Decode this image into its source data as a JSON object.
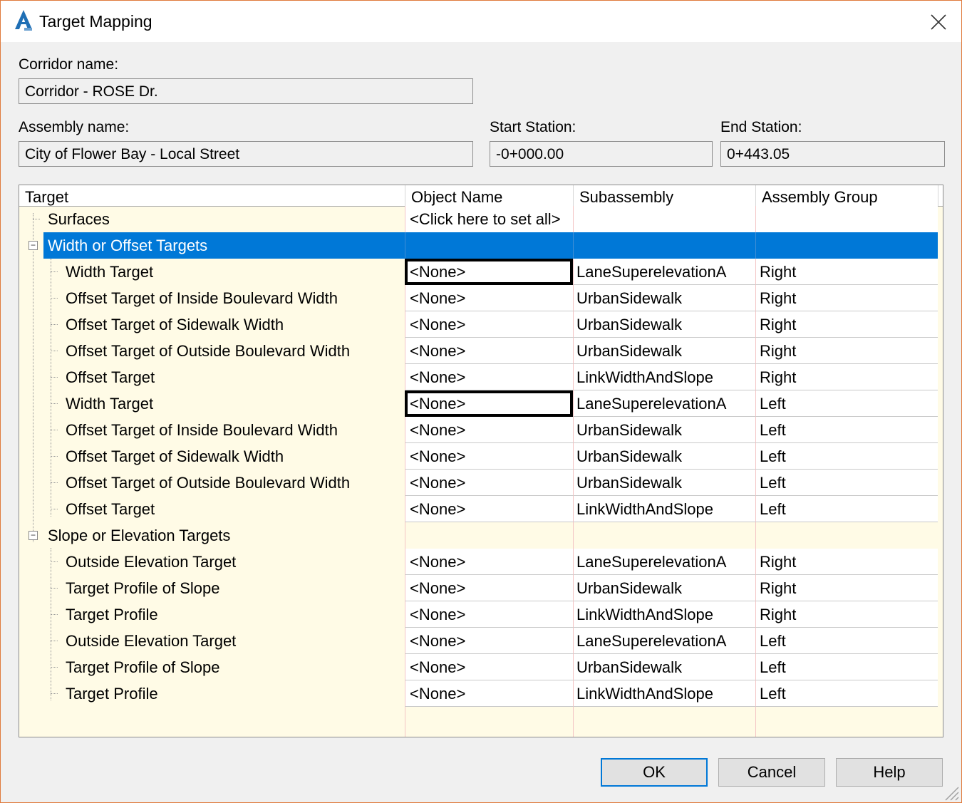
{
  "window": {
    "title": "Target Mapping",
    "app_icon": "autocad-icon",
    "close_icon": "close-icon"
  },
  "corridor": {
    "label": "Corridor name:",
    "value": "Corridor - ROSE Dr."
  },
  "assembly": {
    "label": "Assembly name:",
    "value": "City of Flower Bay - Local Street"
  },
  "start_station": {
    "label": "Start Station:",
    "value": "-0+000.00"
  },
  "end_station": {
    "label": "End Station:",
    "value": "0+443.05"
  },
  "grid": {
    "columns": [
      "Target",
      "Object Name",
      "Subassembly",
      "Assembly Group"
    ],
    "surfaces": {
      "label": "Surfaces",
      "object": "<Click here to set all>"
    },
    "width_group": {
      "label": "Width or Offset Targets"
    },
    "width_rows": [
      {
        "target": "Width Target",
        "object": "<None>",
        "subassembly": "LaneSuperelevationA",
        "group": "Right"
      },
      {
        "target": "Offset Target of Inside Boulevard Width",
        "object": "<None>",
        "subassembly": "UrbanSidewalk",
        "group": "Right"
      },
      {
        "target": "Offset Target of Sidewalk Width",
        "object": "<None>",
        "subassembly": "UrbanSidewalk",
        "group": "Right"
      },
      {
        "target": "Offset Target of Outside Boulevard Width",
        "object": "<None>",
        "subassembly": "UrbanSidewalk",
        "group": "Right"
      },
      {
        "target": "Offset Target",
        "object": "<None>",
        "subassembly": "LinkWidthAndSlope",
        "group": "Right"
      },
      {
        "target": "Width Target",
        "object": "<None>",
        "subassembly": "LaneSuperelevationA",
        "group": "Left"
      },
      {
        "target": "Offset Target of Inside Boulevard Width",
        "object": "<None>",
        "subassembly": "UrbanSidewalk",
        "group": "Left"
      },
      {
        "target": "Offset Target of Sidewalk Width",
        "object": "<None>",
        "subassembly": "UrbanSidewalk",
        "group": "Left"
      },
      {
        "target": "Offset Target of Outside Boulevard Width",
        "object": "<None>",
        "subassembly": "UrbanSidewalk",
        "group": "Left"
      },
      {
        "target": "Offset Target",
        "object": "<None>",
        "subassembly": "LinkWidthAndSlope",
        "group": "Left"
      }
    ],
    "slope_group": {
      "label": "Slope or Elevation Targets"
    },
    "slope_rows": [
      {
        "target": "Outside Elevation Target",
        "object": "<None>",
        "subassembly": "LaneSuperelevationA",
        "group": "Right"
      },
      {
        "target": "Target Profile of Slope",
        "object": "<None>",
        "subassembly": "UrbanSidewalk",
        "group": "Right"
      },
      {
        "target": "Target Profile",
        "object": "<None>",
        "subassembly": "LinkWidthAndSlope",
        "group": "Right"
      },
      {
        "target": "Outside Elevation Target",
        "object": "<None>",
        "subassembly": "LaneSuperelevationA",
        "group": "Left"
      },
      {
        "target": "Target Profile of Slope",
        "object": "<None>",
        "subassembly": "UrbanSidewalk",
        "group": "Left"
      },
      {
        "target": "Target Profile",
        "object": "<None>",
        "subassembly": "LinkWidthAndSlope",
        "group": "Left"
      }
    ]
  },
  "buttons": {
    "ok": "OK",
    "cancel": "Cancel",
    "help": "Help"
  },
  "colors": {
    "selection": "#0078d7",
    "grid_background": "#fffbe6",
    "window_border": "#e07a3c"
  }
}
